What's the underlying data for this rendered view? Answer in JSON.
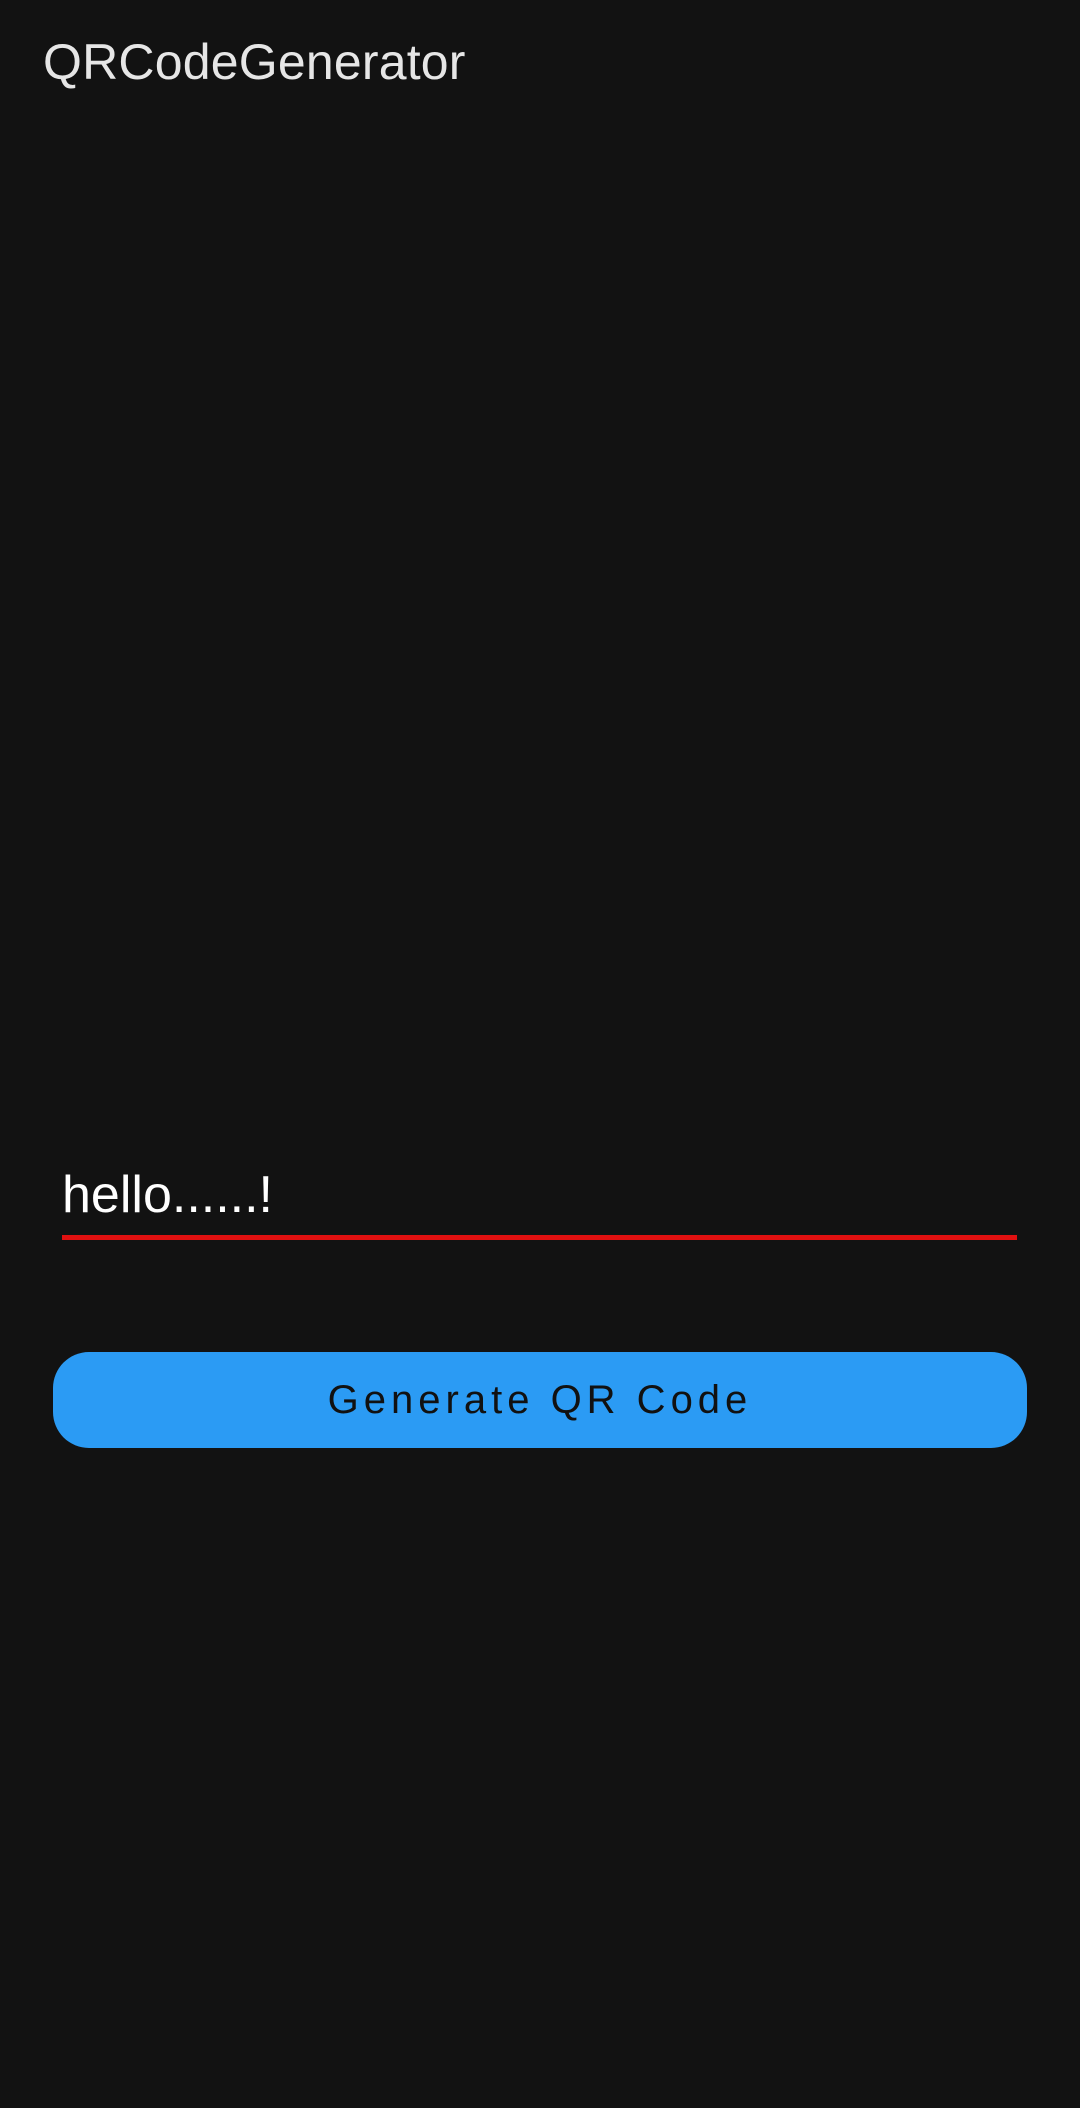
{
  "app": {
    "title": "QRCodeGenerator"
  },
  "input": {
    "value": "hello......!",
    "placeholder": ""
  },
  "button": {
    "label": "Generate QR Code"
  },
  "colors": {
    "background": "#121212",
    "title_text": "#e6e6e6",
    "input_text": "#ffffff",
    "underline_error": "#e01010",
    "button_bg": "#2b9bf4",
    "button_text": "#111111"
  }
}
